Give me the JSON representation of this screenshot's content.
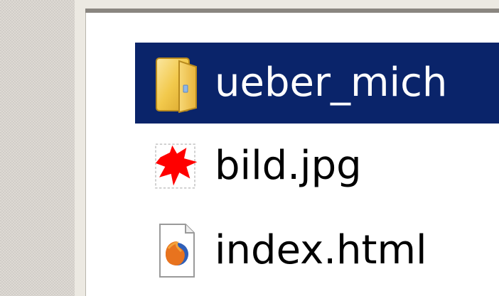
{
  "files": [
    {
      "name": "ueber_mich",
      "icon": "folder-icon",
      "selected": true
    },
    {
      "name": "bild.jpg",
      "icon": "broken-image-icon",
      "selected": false
    },
    {
      "name": "index.html",
      "icon": "firefox-html-file-icon",
      "selected": false
    }
  ],
  "colors": {
    "selection_bg": "#0a246a",
    "selection_text": "#ffffff",
    "text": "#000000",
    "sidebar_bg": "#dedad4",
    "folder_yellow": "#f2c94c",
    "broken_red": "#ff0000"
  }
}
